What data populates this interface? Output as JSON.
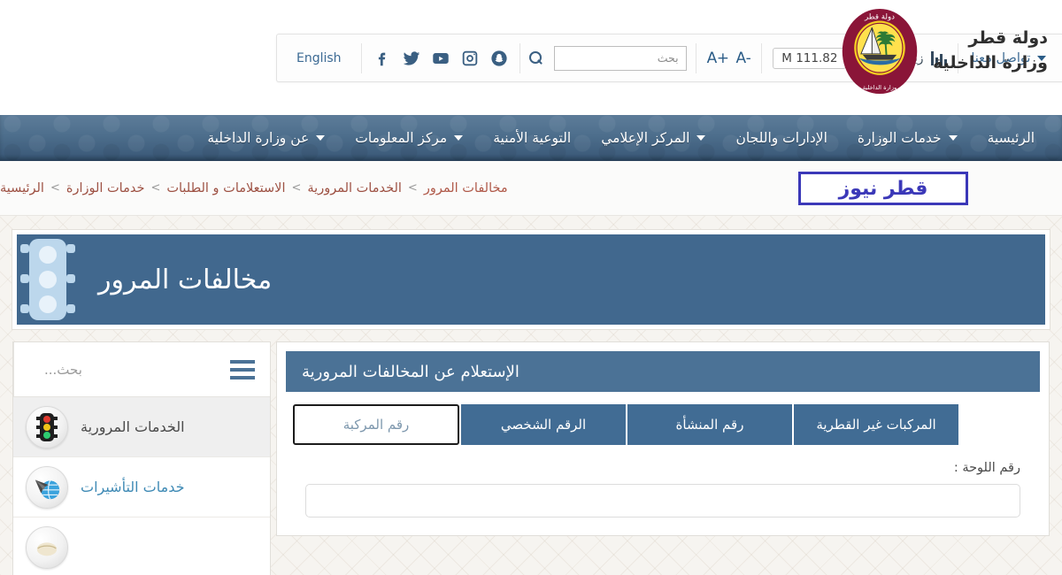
{
  "header": {
    "language_link": "English",
    "social_icons": [
      "snapchat-icon",
      "instagram-icon",
      "youtube-icon",
      "twitter-icon",
      "facebook-icon"
    ],
    "search_icon": "search-icon",
    "search_placeholder": "بحث",
    "search_value": "",
    "font_increase": "+A",
    "font_decrease": "-A",
    "visits_count": "111.82 M",
    "visits_label": "زيارات الموقع",
    "visits_icon": "bar-chart-icon",
    "contact_label": "تواصل معنا",
    "logo": {
      "line1": "دولة قطر",
      "line2": "وزارة الداخلية",
      "emblem": "qatar-moi-emblem"
    }
  },
  "nav": {
    "items": [
      {
        "label": "الرئيسية",
        "has_dropdown": false
      },
      {
        "label": "خدمات الوزارة",
        "has_dropdown": true
      },
      {
        "label": "الإدارات واللجان",
        "has_dropdown": false
      },
      {
        "label": "المركز الإعلامي",
        "has_dropdown": true
      },
      {
        "label": "التوعية الأمنية",
        "has_dropdown": false
      },
      {
        "label": "مركز المعلومات",
        "has_dropdown": true
      },
      {
        "label": "عن وزارة الداخلية",
        "has_dropdown": true
      }
    ]
  },
  "breadcrumb": {
    "separator": ">",
    "items": [
      "الرئيسية",
      "خدمات الوزارة",
      "الاستعلامات و الطلبات",
      "الخدمات المرورية",
      "مخالفات المرور"
    ]
  },
  "watermark": {
    "text": "قطر نيوز",
    "border_color": "#3b38b8",
    "text_color": "#3b38b8"
  },
  "banner": {
    "title": "مخالفات المرور",
    "icon": "traffic-light-icon",
    "background_color": "#41688e"
  },
  "form_card": {
    "header_title": "الإستعلام عن المخالفات المرورية",
    "header_color": "#4b7296",
    "tabs": [
      {
        "label": "رقم المركبة",
        "active": true
      },
      {
        "label": "الرقم الشخصي",
        "active": false
      },
      {
        "label": "رقم المنشأة",
        "active": false
      },
      {
        "label": "المركبات غير القطرية",
        "active": false
      }
    ],
    "field_label": "رقم اللوحة :",
    "field_value": "",
    "field_placeholder": ""
  },
  "sidebar": {
    "menu_icon": "hamburger-menu-icon",
    "search_placeholder": "بحث...",
    "search_value": "",
    "items": [
      {
        "label": "الخدمات المرورية",
        "icon": "traffic-light-icon",
        "active": true
      },
      {
        "label": "خدمات التأشيرات",
        "icon": "visa-globe-icon",
        "active": false
      },
      {
        "label": "",
        "icon": "document-icon",
        "active": false
      }
    ]
  }
}
